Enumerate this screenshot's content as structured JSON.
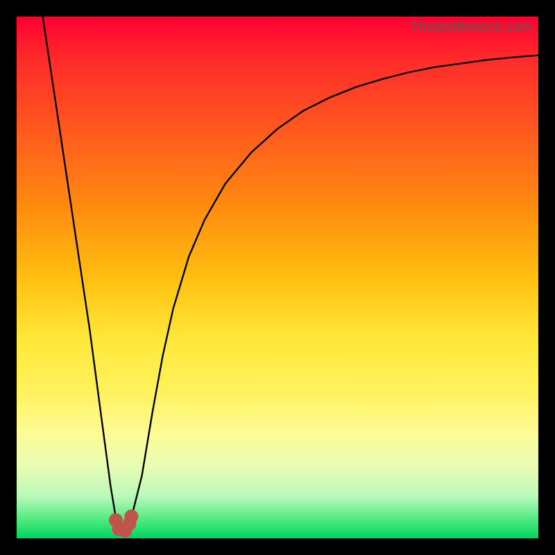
{
  "watermark": "TheBottleneck.com",
  "chart_data": {
    "type": "line",
    "title": "",
    "xlabel": "",
    "ylabel": "",
    "xlim": [
      0,
      100
    ],
    "ylim": [
      0,
      100
    ],
    "grid": false,
    "series": [
      {
        "name": "bottleneck-curve",
        "color": "#000000",
        "x": [
          5,
          8,
          11,
          14,
          16,
          18,
          19,
          20,
          21,
          22,
          24,
          26,
          28,
          30,
          33,
          36,
          40,
          45,
          50,
          55,
          60,
          65,
          70,
          75,
          80,
          85,
          90,
          95,
          100
        ],
        "y": [
          100,
          80,
          60,
          40,
          25,
          10,
          4,
          2,
          2,
          4,
          12,
          24,
          35,
          44,
          54,
          61,
          68,
          74,
          78.5,
          82,
          84.5,
          86.5,
          88,
          89.3,
          90.3,
          91,
          91.7,
          92.2,
          92.6
        ]
      }
    ],
    "markers": [
      {
        "name": "point-1",
        "x": 19.0,
        "y": 3.5,
        "color": "#c1544a"
      },
      {
        "name": "point-2",
        "x": 19.6,
        "y": 1.8,
        "color": "#c1544a"
      },
      {
        "name": "point-3",
        "x": 20.8,
        "y": 1.5,
        "color": "#c1544a"
      },
      {
        "name": "point-4",
        "x": 21.6,
        "y": 2.8,
        "color": "#c1544a"
      },
      {
        "name": "point-5",
        "x": 22.0,
        "y": 4.2,
        "color": "#c1544a"
      }
    ],
    "background_gradient_stops": [
      {
        "pos": 0,
        "color": "#ff0030"
      },
      {
        "pos": 22,
        "color": "#ff5a1e"
      },
      {
        "pos": 50,
        "color": "#ffbf10"
      },
      {
        "pos": 72,
        "color": "#fff25e"
      },
      {
        "pos": 92,
        "color": "#b8f9b8"
      },
      {
        "pos": 100,
        "color": "#00d362"
      }
    ]
  }
}
